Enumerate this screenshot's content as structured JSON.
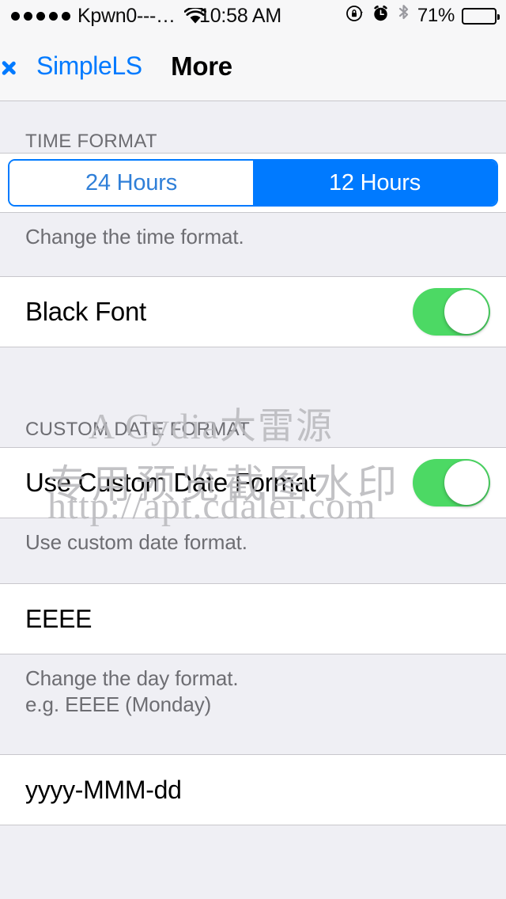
{
  "status_bar": {
    "signal_dots": 5,
    "carrier": "Kpwn0---…",
    "wifi_icon": "wifi-icon",
    "time": "10:58 AM",
    "rotation_lock_icon": "rotation-lock-icon",
    "alarm_icon": "alarm-clock-icon",
    "bluetooth_icon": "bluetooth-icon",
    "battery_percent": "71%",
    "battery_level": 71
  },
  "nav_bar": {
    "back_label": "SimpleLS",
    "back_icon": "chevron-left-icon",
    "title": "More"
  },
  "sections": {
    "time_format": {
      "header": "TIME FORMAT",
      "segmented": {
        "options": [
          "24 Hours",
          "12 Hours"
        ],
        "selected_index": 1
      },
      "footer": "Change the time format."
    },
    "black_font": {
      "label": "Black Font",
      "switch_state": "on"
    },
    "custom_date_format": {
      "header": "CUSTOM DATE FORMAT",
      "use_custom": {
        "label": "Use Custom Date Format",
        "switch_state": "on"
      },
      "footer_use_custom": "Use custom date format.",
      "day_format": {
        "value": "EEEE"
      },
      "footer_day_format": "Change the day format.\ne.g. EEEE (Monday)",
      "date_format": {
        "value": "yyyy-MMM-dd"
      }
    }
  },
  "watermark": {
    "line1": "A Cydia大雷源",
    "line2": "专用预览截图水印",
    "line3": "http://apt.cdalei.com"
  },
  "colors": {
    "accent_blue": "#007aff",
    "switch_green": "#4cd964",
    "background": "#efeff4",
    "separator": "#c8c7cc",
    "secondary_text": "#6d6d72"
  }
}
